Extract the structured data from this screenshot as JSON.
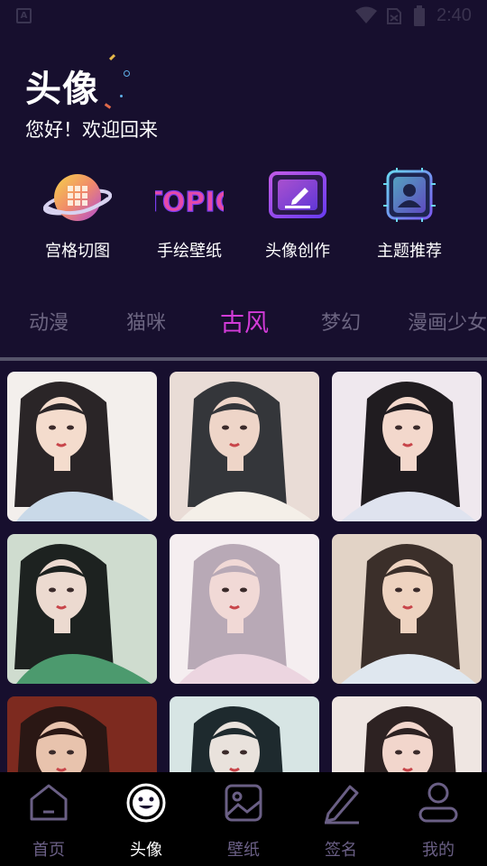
{
  "status_bar": {
    "app_indicator": "A",
    "time": "2:40"
  },
  "header": {
    "title": "头像",
    "subtitle": "您好！欢迎回来"
  },
  "features": [
    {
      "label": "宫格切图",
      "icon": "grid-planet-icon"
    },
    {
      "label": "手绘壁纸",
      "icon": "topic-icon",
      "icon_text": "TOPIC"
    },
    {
      "label": "头像创作",
      "icon": "edit-card-icon"
    },
    {
      "label": "主题推荐",
      "icon": "avatar-frame-icon"
    }
  ],
  "tabs": [
    {
      "label": "动漫",
      "active": false
    },
    {
      "label": "猫咪",
      "active": false
    },
    {
      "label": "古风",
      "active": true
    },
    {
      "label": "梦幻",
      "active": false
    },
    {
      "label": "漫画少女",
      "active": false
    }
  ],
  "gallery": {
    "palettes": [
      {
        "bg": "#f3efec",
        "skin": "#f4dccd",
        "hair": "#2a2527",
        "robe": "#c9d9e8"
      },
      {
        "bg": "#e9dcd6",
        "skin": "#eed5c8",
        "hair": "#34363a",
        "robe": "#f4efe8"
      },
      {
        "bg": "#efe8ee",
        "skin": "#f3d8cc",
        "hair": "#201c20",
        "robe": "#dfe3ef"
      },
      {
        "bg": "#cfdccf",
        "skin": "#ecdad0",
        "hair": "#1d2220",
        "robe": "#4c9a6e"
      },
      {
        "bg": "#f5eef0",
        "skin": "#f1d9d6",
        "hair": "#b8a9b6",
        "robe": "#ecd5e0"
      },
      {
        "bg": "#e2d3c6",
        "skin": "#eed3c0",
        "hair": "#3b2f2a",
        "robe": "#dfe7ef"
      },
      {
        "bg": "#7d2a1f",
        "skin": "#e8c3ad",
        "hair": "#2a1714",
        "robe": "#a8362a"
      },
      {
        "bg": "#d7e5e4",
        "skin": "#e9e2dc",
        "hair": "#1e2a2e",
        "robe": "#b6cfd2"
      },
      {
        "bg": "#efe6e2",
        "skin": "#f2d6cc",
        "hair": "#2d2222",
        "robe": "#e9dcd6"
      }
    ]
  },
  "bottom_nav": [
    {
      "label": "首页",
      "icon": "home-icon",
      "active": false
    },
    {
      "label": "头像",
      "icon": "smiley-icon",
      "active": true
    },
    {
      "label": "壁纸",
      "icon": "image-icon",
      "active": false
    },
    {
      "label": "签名",
      "icon": "pen-icon",
      "active": false
    },
    {
      "label": "我的",
      "icon": "user-icon",
      "active": false
    }
  ],
  "colors": {
    "background": "#170f2e",
    "accent": "#d23bd8",
    "tab_inactive": "#6b6480",
    "nav_inactive": "#6a5f85"
  }
}
